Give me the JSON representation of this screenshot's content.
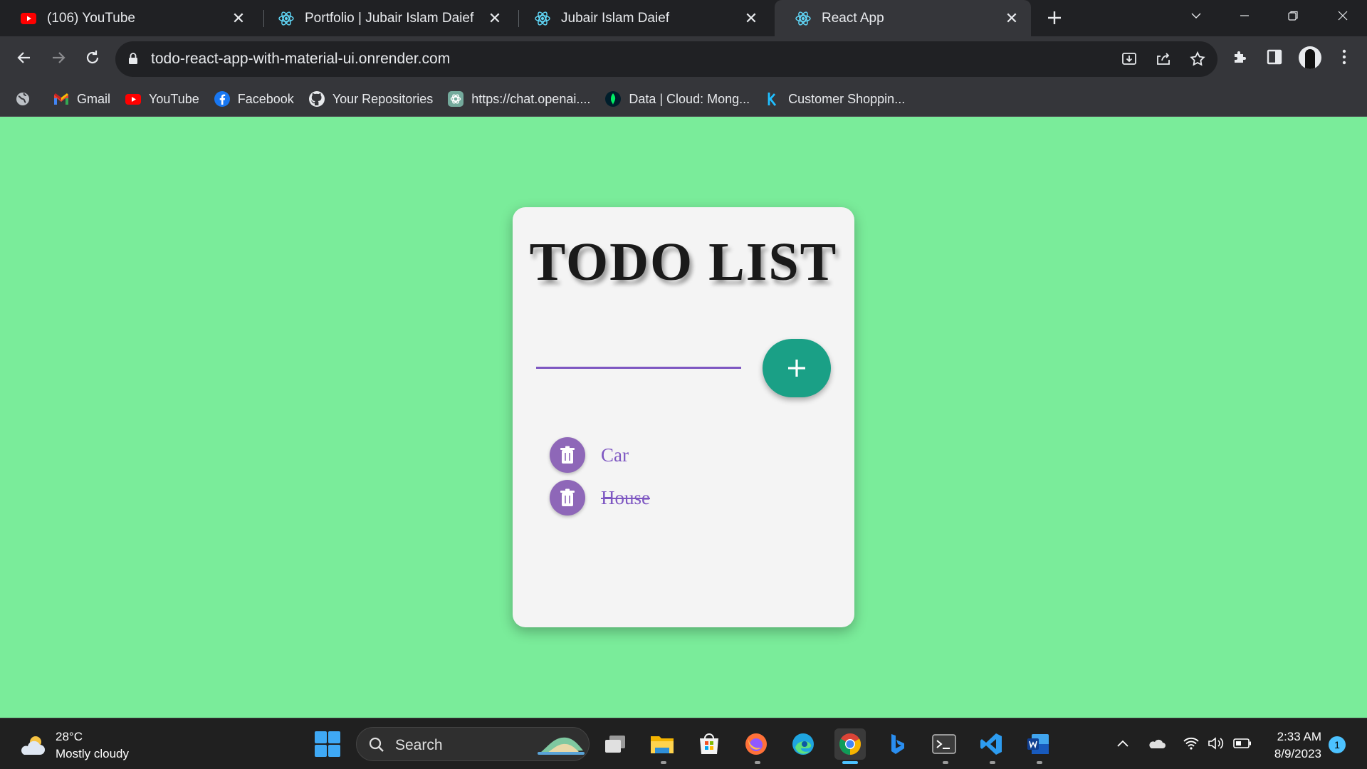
{
  "browser": {
    "tabs": [
      {
        "label": "(106) YouTube",
        "icon": "youtube-icon"
      },
      {
        "label": "Portfolio | Jubair Islam Daief",
        "icon": "react-icon"
      },
      {
        "label": "Jubair Islam Daief",
        "icon": "react-icon"
      },
      {
        "label": "React App",
        "icon": "react-icon",
        "active": true
      }
    ],
    "url": "todo-react-app-with-material-ui.onrender.com",
    "bookmarks": [
      {
        "label": "Gmail",
        "icon": "gmail-icon"
      },
      {
        "label": "YouTube",
        "icon": "youtube-icon"
      },
      {
        "label": "Facebook",
        "icon": "facebook-icon"
      },
      {
        "label": "Your Repositories",
        "icon": "github-icon"
      },
      {
        "label": "https://chat.openai....",
        "icon": "openai-icon"
      },
      {
        "label": "Data | Cloud: Mong...",
        "icon": "mongodb-icon"
      },
      {
        "label": "Customer Shoppin...",
        "icon": "kaggle-icon"
      }
    ]
  },
  "app": {
    "title": "TODO LIST",
    "input_value": "",
    "items": [
      {
        "text": "Car",
        "done": false
      },
      {
        "text": "House",
        "done": true
      }
    ],
    "colors": {
      "background": "#7aec9a",
      "card": "#f4f4f4",
      "accent": "#7e57c2",
      "add_button": "#1aa086",
      "delete_button": "#8e67b8"
    }
  },
  "taskbar": {
    "weather": {
      "temp": "28°C",
      "condition": "Mostly cloudy"
    },
    "search_label": "Search",
    "time": "2:33 AM",
    "date": "8/9/2023",
    "notifications": "1"
  }
}
